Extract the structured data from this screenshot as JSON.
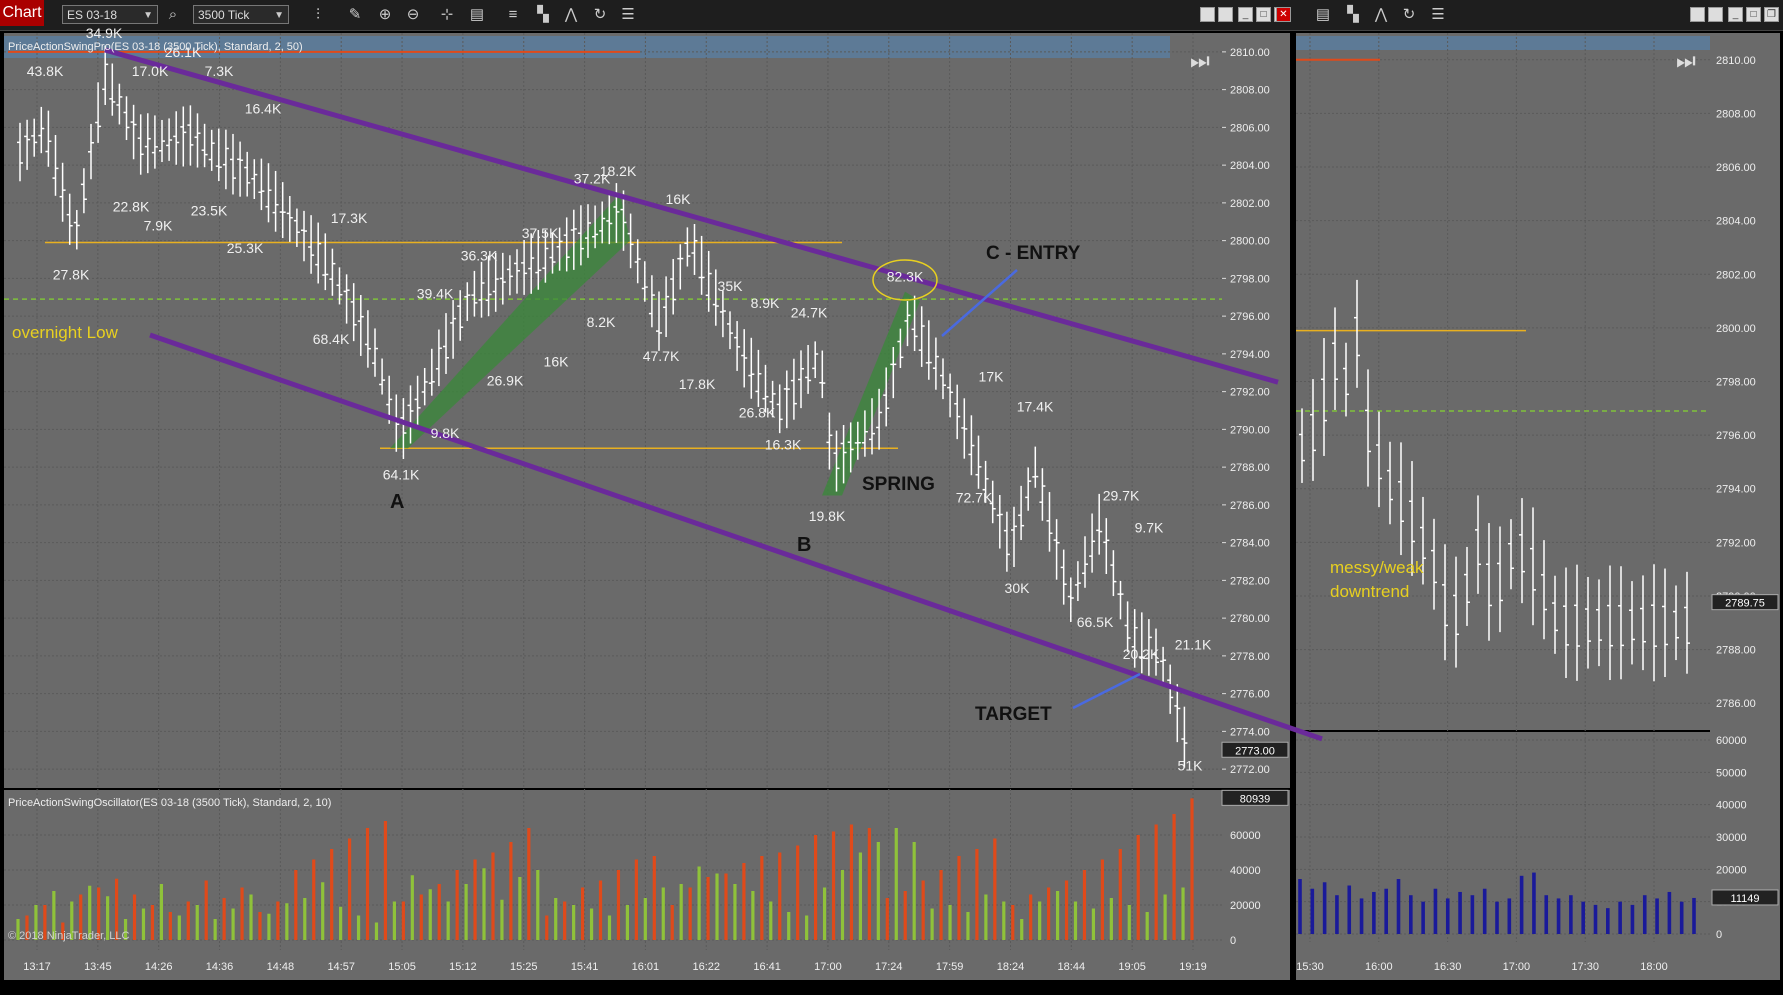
{
  "toolbar": {
    "chart_label": "Chart",
    "instrument": "ES 03-18",
    "interval": "3500 Tick",
    "icons": [
      "search-icon",
      "bar-style-icon",
      "pencil-icon",
      "zoom-in-icon",
      "zoom-out-icon",
      "crosshair-icon",
      "properties-icon",
      "indicators-icon",
      "strategies-icon",
      "draw-tools-icon",
      "reload-icon",
      "data-box-icon"
    ]
  },
  "colors": {
    "panel_bg": "#6a6a6a",
    "grid": "#5a5a5a",
    "bar": "#ffffff",
    "trend_line": "#6a2a9a",
    "horizontal_line": "#e8b020",
    "dashed_line": "#7fc23a",
    "channel_green": "#3a8a3a",
    "osc_up": "#8fc23a",
    "osc_down": "#e04a1a",
    "right_osc": "#1a1a9a",
    "annotation_text": "#e8d020"
  },
  "chart_data": [
    {
      "type": "candlestick",
      "panel": "main-left",
      "indicator_title": "PriceActionSwingPro(ES 03-18 (3500 Tick), Standard, 2, 50)",
      "ylim": [
        2771,
        2811
      ],
      "y_ticks": [
        "2810.00",
        "2808.00",
        "2806.00",
        "2804.00",
        "2802.00",
        "2800.00",
        "2798.00",
        "2796.00",
        "2794.00",
        "2792.00",
        "2790.00",
        "2788.00",
        "2786.00",
        "2784.00",
        "2782.00",
        "2780.00",
        "2778.00",
        "2776.00",
        "2774.00",
        "2772.00"
      ],
      "x_ticks": [
        "13:17",
        "13:45",
        "14:26",
        "14:36",
        "14:48",
        "14:57",
        "15:05",
        "15:12",
        "15:25",
        "15:41",
        "16:01",
        "16:22",
        "16:41",
        "17:00",
        "17:24",
        "17:59",
        "18:24",
        "18:44",
        "19:05",
        "19:19"
      ],
      "last_price_label": "2773.00",
      "swing_volume_labels": [
        "43.8K",
        "34.9K",
        "17.0K",
        "26.1K",
        "7.3K",
        "16.4K",
        "22.8K",
        "7.9K",
        "23.5K",
        "25.3K",
        "27.8K",
        "17.3K",
        "68.4K",
        "39.4K",
        "36.3K",
        "37.5K",
        "37.2K",
        "18.2K",
        "16K",
        "26.9K",
        "16K",
        "8.2K",
        "47.7K",
        "35K",
        "8.9K",
        "24.7K",
        "82.3K",
        "17.8K",
        "26.8K",
        "16.3K",
        "9.8K",
        "64.1K",
        "19.8K",
        "17K",
        "17.4K",
        "72.7K",
        "29.7K",
        "9.7K",
        "30K",
        "66.5K",
        "20.2K",
        "21.1K",
        "51K"
      ],
      "annotations": [
        "overnight Low",
        "A",
        "B",
        "SPRING",
        "C - ENTRY",
        "TARGET"
      ]
    },
    {
      "type": "bar",
      "panel": "oscillator-left",
      "indicator_title": "PriceActionSwingOscillator(ES 03-18 (3500 Tick), Standard, 2, 10)",
      "ylim": [
        0,
        80000
      ],
      "y_ticks": [
        "60000",
        "40000",
        "20000",
        "0"
      ],
      "last_value_label": "80939",
      "series": [
        {
          "name": "up",
          "values": [
            12000,
            20000,
            28000,
            22000,
            31000,
            25000,
            12000,
            18000,
            32000,
            14000,
            20000,
            12000,
            18000,
            26000,
            15000,
            21000,
            24000,
            33000,
            19000,
            14000,
            10000,
            22000,
            37000,
            29000,
            22000,
            32000,
            41000,
            23000,
            36000,
            40000,
            24000,
            20000,
            18000,
            14000,
            20000,
            24000,
            30000,
            32000,
            42000,
            38000,
            32000,
            28000,
            22000,
            16000,
            14000,
            30000,
            40000,
            50000,
            56000,
            64000,
            56000,
            18000,
            20000,
            16000,
            26000,
            22000,
            12000,
            22000,
            28000,
            22000,
            18000,
            24000,
            20000,
            16000,
            26000,
            30000
          ]
        },
        {
          "name": "down",
          "values": [
            14000,
            20000,
            10000,
            26000,
            30000,
            35000,
            26000,
            20000,
            16000,
            22000,
            34000,
            24000,
            30000,
            16000,
            22000,
            40000,
            46000,
            52000,
            58000,
            64000,
            68000,
            22000,
            26000,
            32000,
            40000,
            46000,
            50000,
            56000,
            64000,
            14000,
            22000,
            30000,
            34000,
            40000,
            46000,
            48000,
            20000,
            30000,
            36000,
            38000,
            44000,
            48000,
            50000,
            54000,
            60000,
            62000,
            66000,
            64000,
            24000,
            28000,
            34000,
            40000,
            48000,
            52000,
            58000,
            20000,
            26000,
            30000,
            34000,
            40000,
            46000,
            52000,
            60000,
            66000,
            72000,
            80939
          ]
        }
      ]
    },
    {
      "type": "candlestick",
      "panel": "main-right",
      "ylim": [
        2785,
        2811
      ],
      "y_ticks": [
        "2810.00",
        "2808.00",
        "2806.00",
        "2804.00",
        "2802.00",
        "2800.00",
        "2798.00",
        "2796.00",
        "2794.00",
        "2792.00",
        "2790.00",
        "2788.00",
        "2786.00"
      ],
      "x_ticks": [
        "15:30",
        "16:00",
        "16:30",
        "17:00",
        "17:30",
        "18:00"
      ],
      "last_price_label": "2789.75",
      "annotations": [
        "messy/weak",
        "downtrend"
      ]
    },
    {
      "type": "bar",
      "panel": "oscillator-right",
      "ylim": [
        0,
        60000
      ],
      "y_ticks": [
        "60000",
        "50000",
        "40000",
        "30000",
        "20000",
        "10000",
        "0"
      ],
      "last_value_label": "11149",
      "values": [
        17000,
        14000,
        16000,
        12000,
        15000,
        11000,
        13000,
        14000,
        17000,
        12000,
        10000,
        14000,
        11000,
        13000,
        12000,
        14000,
        10000,
        11000,
        18000,
        19000,
        12000,
        11000,
        12000,
        10000,
        9000,
        8000,
        10000,
        9000,
        12000,
        11000,
        13000,
        10000,
        11149
      ]
    }
  ],
  "copyright": "© 2018 NinjaTrader, LLC"
}
